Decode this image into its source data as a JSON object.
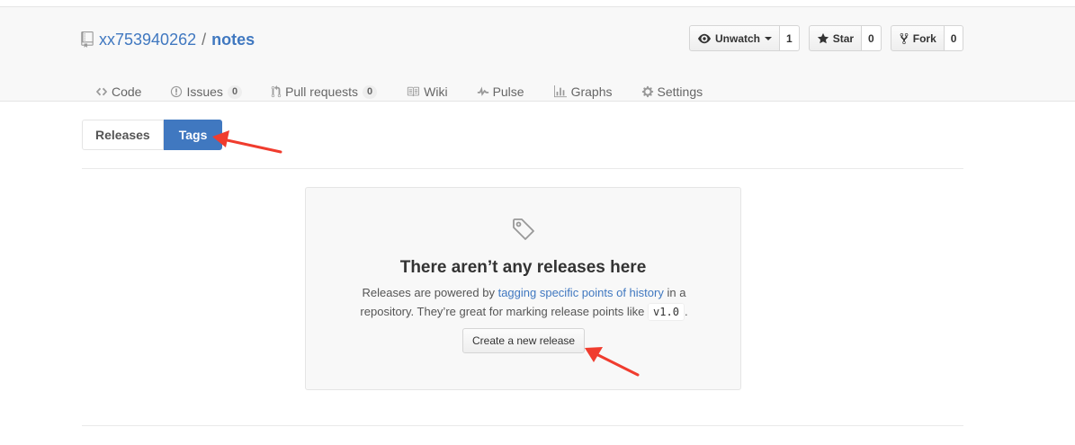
{
  "repo": {
    "owner": "xx753940262",
    "separator": "/",
    "name": "notes"
  },
  "actions": {
    "watch": {
      "label": "Unwatch",
      "count": "1"
    },
    "star": {
      "label": "Star",
      "count": "0"
    },
    "fork": {
      "label": "Fork",
      "count": "0"
    }
  },
  "nav": {
    "code": "Code",
    "issues": {
      "label": "Issues",
      "count": "0"
    },
    "pulls": {
      "label": "Pull requests",
      "count": "0"
    },
    "wiki": "Wiki",
    "pulse": "Pulse",
    "graphs": "Graphs",
    "settings": "Settings"
  },
  "subnav": {
    "releases": "Releases",
    "tags": "Tags",
    "selected": "Tags"
  },
  "blankslate": {
    "icon": "tag-icon",
    "title": "There aren’t any releases here",
    "text_before_link": "Releases are powered by ",
    "link": "tagging specific points of history",
    "text_after_link": " in a repository. They’re great for marking release points like ",
    "code": "v1.0",
    "text_end": ".",
    "button": "Create a new release"
  },
  "colors": {
    "accent": "#4078c0",
    "annotation": "#f03c2e"
  }
}
